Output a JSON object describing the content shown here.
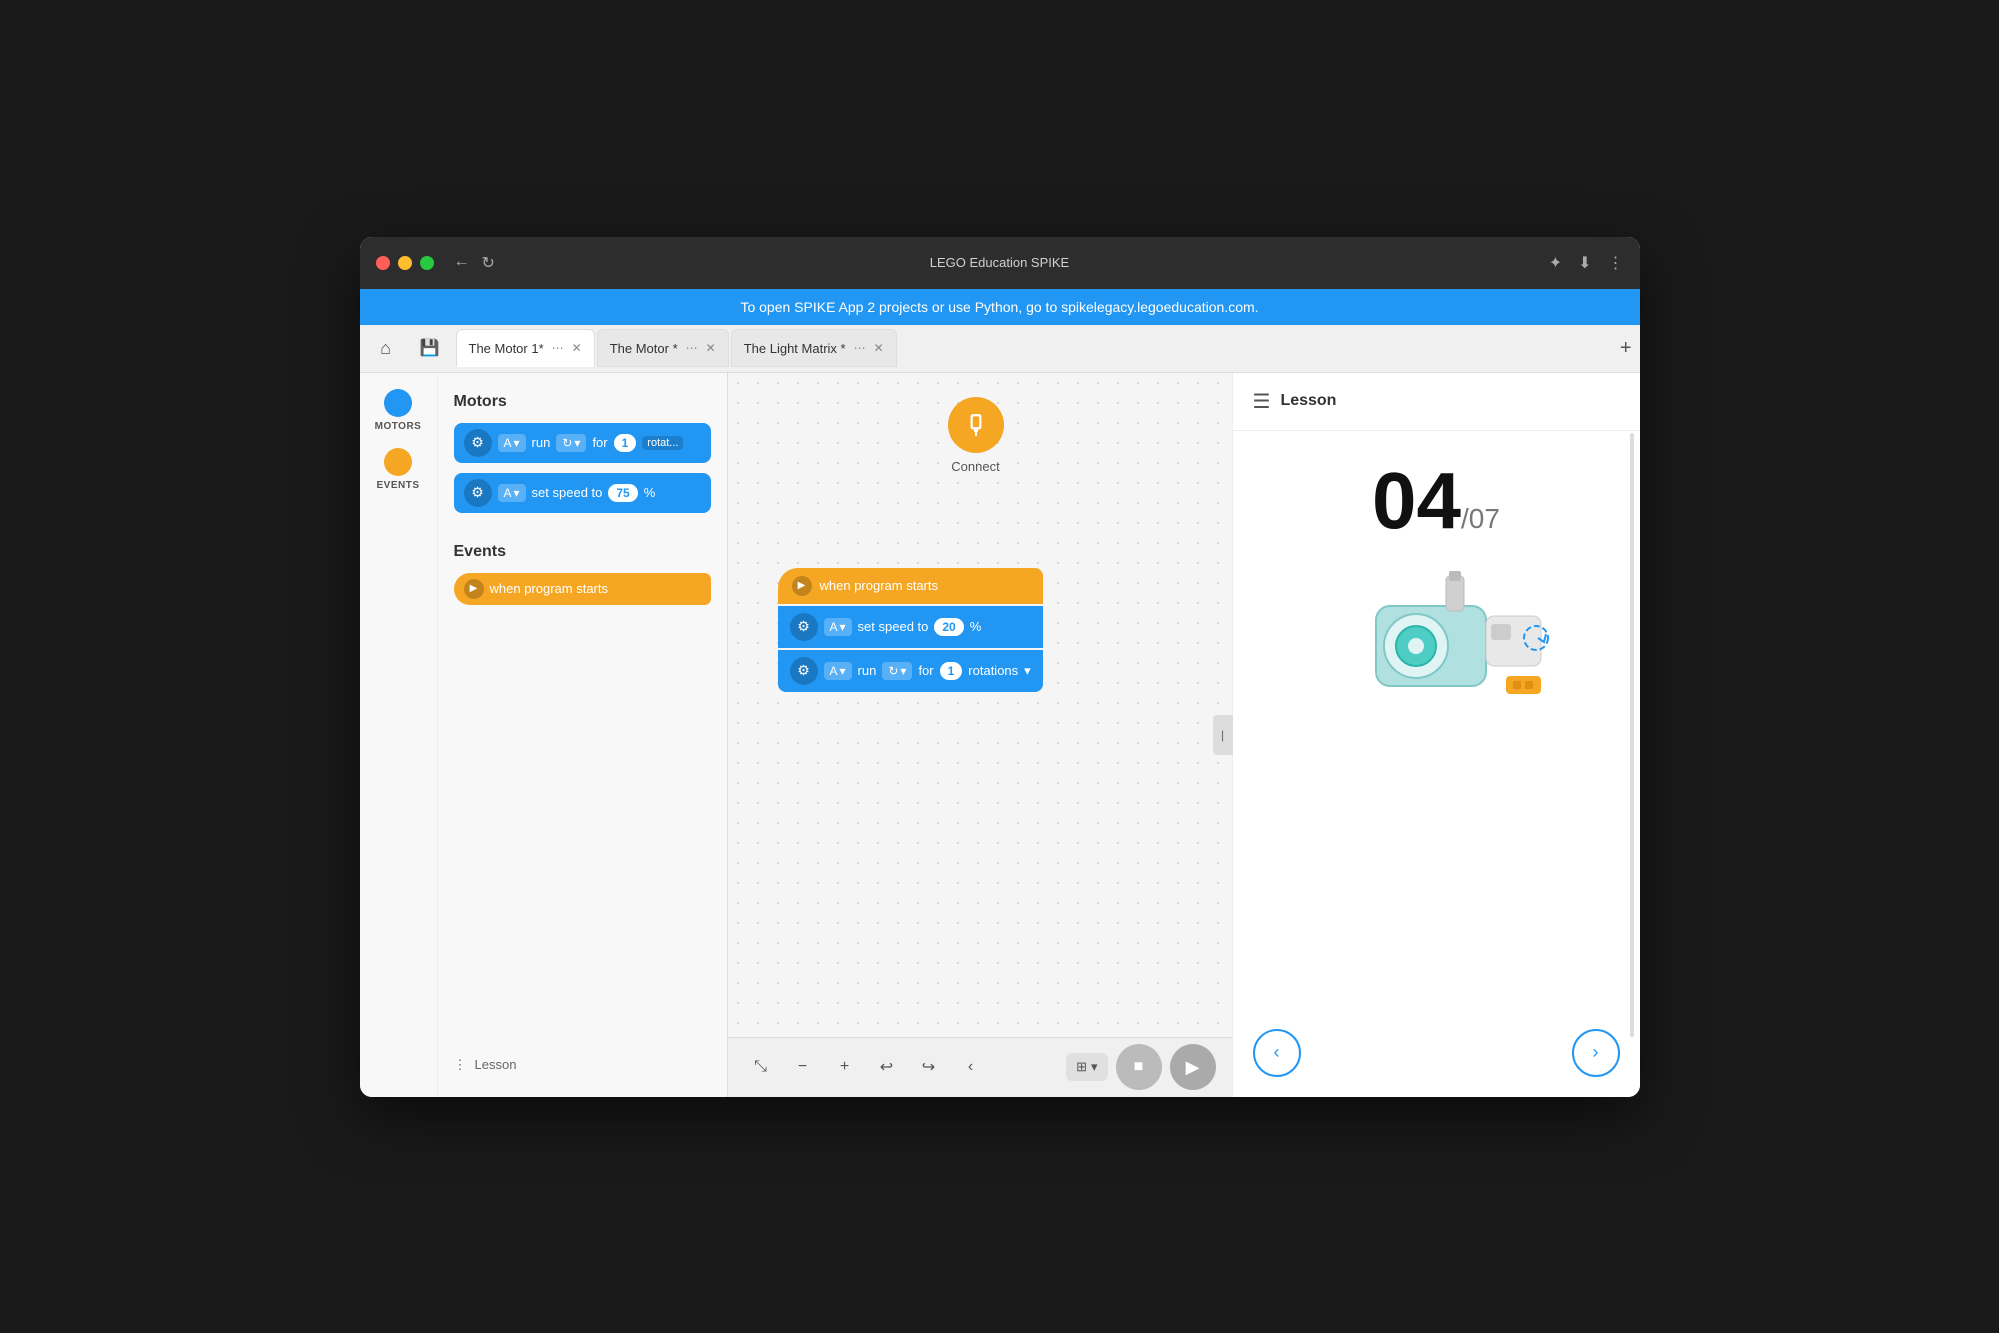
{
  "titlebar": {
    "title": "LEGO Education SPIKE",
    "back_btn": "←",
    "refresh_btn": "↻"
  },
  "banner": {
    "text": "To open SPIKE App 2 projects or use Python, go to spikelegacy.legoeducation.com."
  },
  "tabs": [
    {
      "label": "The Motor 1*",
      "active": true
    },
    {
      "label": "The Motor *",
      "active": false
    },
    {
      "label": "The Light Matrix *",
      "active": false
    }
  ],
  "sidebar": {
    "categories": [
      {
        "label": "MOTORS",
        "color": "blue"
      },
      {
        "label": "EVENTS",
        "color": "yellow"
      }
    ]
  },
  "blocks": {
    "motors_title": "Motors",
    "events_title": "Events",
    "motor_block_1": {
      "port": "A",
      "action": "run",
      "quantity": "1",
      "unit": "rotat..."
    },
    "motor_block_2": {
      "port": "A",
      "action": "set speed to",
      "value": "75",
      "unit": "%"
    },
    "event_block_1": {
      "label": "when program starts"
    }
  },
  "canvas": {
    "connect_label": "Connect",
    "block_group": {
      "trigger": "when program starts",
      "block1_port": "A",
      "block1_action": "set speed to",
      "block1_value": "20",
      "block1_unit": "%",
      "block2_port": "A",
      "block2_action": "run",
      "block2_quantity": "1",
      "block2_unit": "rotations"
    }
  },
  "lesson": {
    "title": "Lesson",
    "current": "04",
    "separator": "/",
    "total": "07",
    "prev_btn": "‹",
    "next_btn": "›"
  },
  "bottom_toolbar": {
    "collapse_btn": "⤢",
    "zoom_out": "−",
    "zoom_in": "+",
    "undo": "↩",
    "redo": "↪",
    "back_arrow": "‹",
    "grid_btn": "⊞",
    "grid_chevron": "▾",
    "stop_icon": "■",
    "play_icon": "▶",
    "lesson_label": "Lesson",
    "lesson_dots": "⋮"
  }
}
